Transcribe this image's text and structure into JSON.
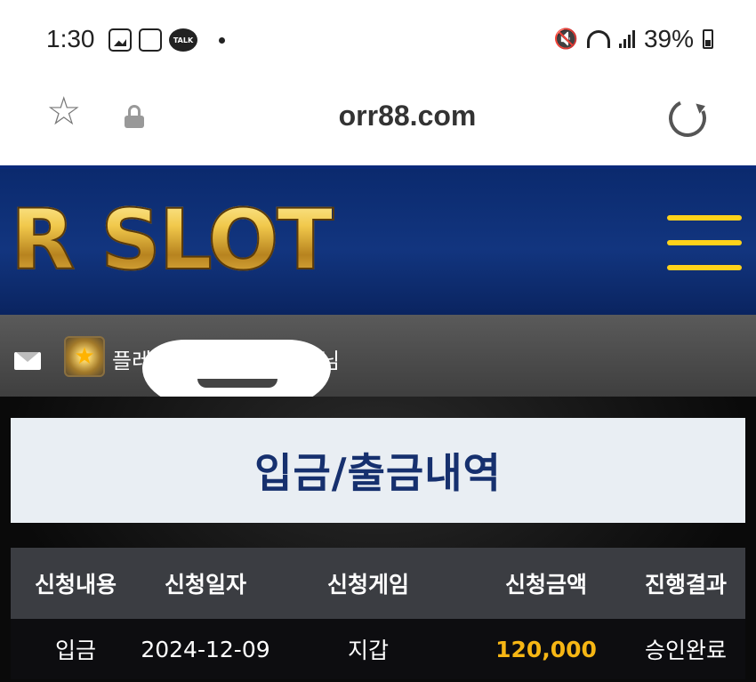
{
  "status_bar": {
    "time": "1:30",
    "talk_badge": "TALK",
    "battery_percent": "39%"
  },
  "browser": {
    "url": "orr88.com"
  },
  "site": {
    "logo_text": "R SLOT",
    "accent_color": "#ffd21a",
    "header_color": "#12357f"
  },
  "user_bar": {
    "name_visible": "플레",
    "name_suffix": "님"
  },
  "page": {
    "title": "입금/출금내역"
  },
  "table": {
    "columns": [
      "신청내용",
      "신청일자",
      "신청게임",
      "신청금액",
      "진행결과"
    ],
    "rows": [
      [
        "입금",
        "2024-12-09",
        "지갑",
        "120,000",
        "승인완료"
      ]
    ]
  }
}
